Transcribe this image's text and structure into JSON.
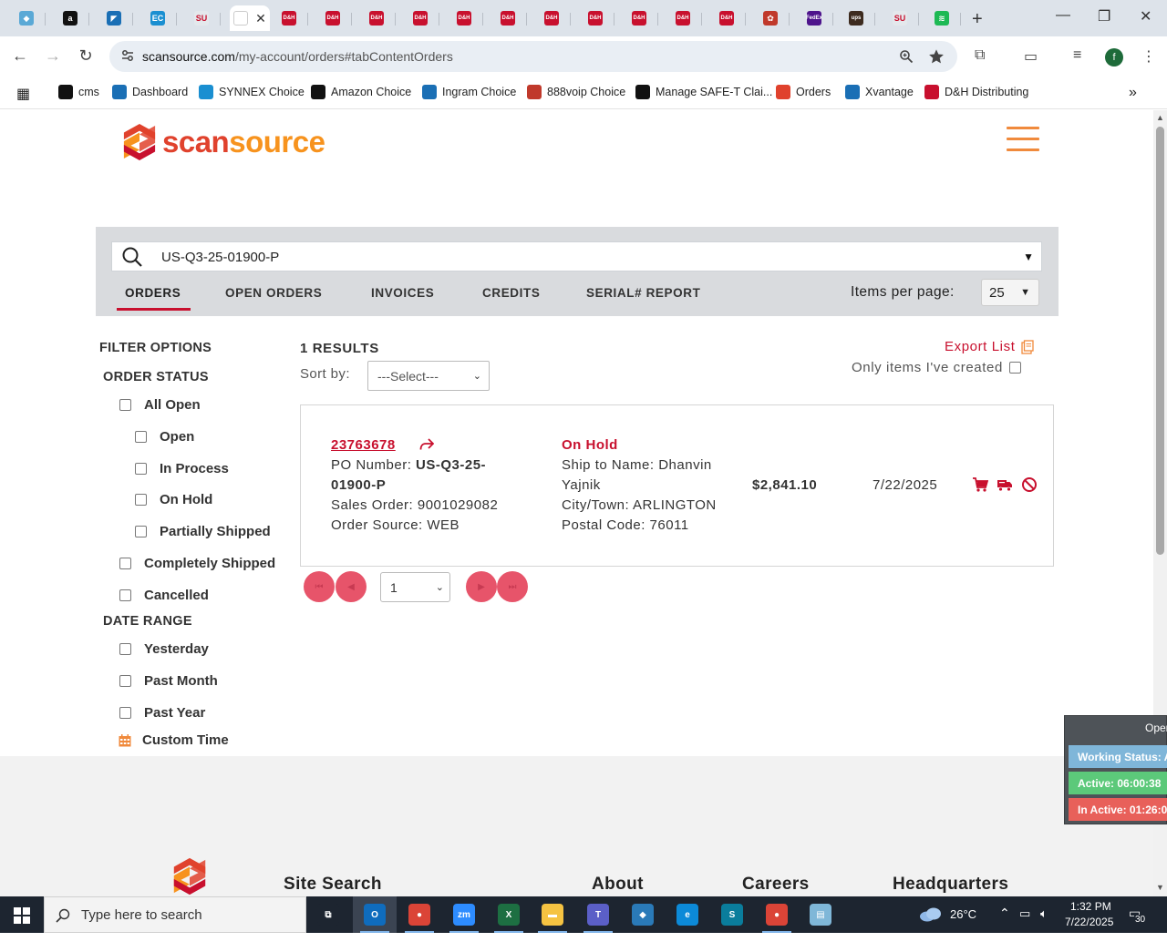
{
  "browser": {
    "active_tab_close": "✕",
    "new_tab": "+",
    "url_host": "scansource.com",
    "url_path": "/my-account/orders#tabContentOrders",
    "window_controls": {
      "minimize": "—",
      "restore": "❐",
      "close": "✕"
    },
    "profile_initial": "f",
    "tabs": [
      {
        "icon": "chrome-icon",
        "color": "#5aa9d6",
        "glyph": "◆"
      },
      {
        "icon": "amazon-icon",
        "color": "#111111",
        "glyph": "a"
      },
      {
        "icon": "ingram-icon",
        "color": "#1a6fb5",
        "glyph": "◤"
      },
      {
        "icon": "ec-icon",
        "color": "#1a8fd1",
        "glyph": "EC"
      },
      {
        "icon": "synnex-icon",
        "color": "#e4e8ec",
        "glyph": "SU"
      },
      {
        "icon": "dh-icon",
        "color": "#c8102e",
        "glyph": "D&H"
      },
      {
        "icon": "dh-icon",
        "color": "#c8102e",
        "glyph": "D&H"
      },
      {
        "icon": "dh-icon",
        "color": "#c8102e",
        "glyph": "D&H"
      },
      {
        "icon": "dh-icon",
        "color": "#c8102e",
        "glyph": "D&H"
      },
      {
        "icon": "dh-icon",
        "color": "#c8102e",
        "glyph": "D&H"
      },
      {
        "icon": "dh-icon",
        "color": "#c8102e",
        "glyph": "D&H"
      },
      {
        "icon": "dh-icon",
        "color": "#c8102e",
        "glyph": "D&H"
      },
      {
        "icon": "dh-icon",
        "color": "#c8102e",
        "glyph": "D&H"
      },
      {
        "icon": "dh-icon",
        "color": "#c8102e",
        "glyph": "D&H"
      },
      {
        "icon": "dh-icon",
        "color": "#c8102e",
        "glyph": "D&H"
      },
      {
        "icon": "dh-icon",
        "color": "#c8102e",
        "glyph": "D&H"
      },
      {
        "icon": "voip-icon",
        "color": "#c0392b",
        "glyph": "✿"
      },
      {
        "icon": "fedex-icon",
        "color": "#4d148c",
        "glyph": "FedEx"
      },
      {
        "icon": "ups-icon",
        "color": "#3d2b1f",
        "glyph": "ups"
      },
      {
        "icon": "synnex-icon",
        "color": "#e4e8ec",
        "glyph": "SU"
      },
      {
        "icon": "spotify-icon",
        "color": "#1db954",
        "glyph": "≋"
      }
    ]
  },
  "bookmarks": [
    {
      "label": "cms",
      "icon": "cms-icon",
      "color": "#111111"
    },
    {
      "label": "Dashboard",
      "icon": "dashboard-icon",
      "color": "#1a6fb5"
    },
    {
      "label": "SYNNEX Choice",
      "icon": "ec-icon",
      "color": "#1a8fd1"
    },
    {
      "label": "Amazon Choice",
      "icon": "amazon-icon",
      "color": "#111111"
    },
    {
      "label": "Ingram Choice",
      "icon": "ingram-icon",
      "color": "#1a6fb5"
    },
    {
      "label": "888voip Choice",
      "icon": "voip-icon",
      "color": "#c0392b"
    },
    {
      "label": "Manage SAFE-T Clai...",
      "icon": "amazon-icon",
      "color": "#111111"
    },
    {
      "label": "Orders",
      "icon": "scansource-icon",
      "color": "#e0422d"
    },
    {
      "label": "Xvantage",
      "icon": "ingram-icon",
      "color": "#1a6fb5"
    },
    {
      "label": "D&H Distributing",
      "icon": "dh-icon",
      "color": "#c8102e"
    }
  ],
  "bookmarks_more": "»",
  "site": {
    "logo_text_a": "scan",
    "logo_text_b": "source",
    "brand_red": "#e0422d",
    "brand_orange": "#f7931e",
    "accent": "#c8102e"
  },
  "search": {
    "query": "US-Q3-25-01900-P",
    "dropdown": "▼"
  },
  "tabs": [
    {
      "label": "ORDERS",
      "active": true
    },
    {
      "label": "OPEN ORDERS"
    },
    {
      "label": "INVOICES"
    },
    {
      "label": "CREDITS"
    },
    {
      "label": "SERIAL# REPORT"
    }
  ],
  "items_per_page": {
    "label": "Items per page:",
    "value": "25",
    "caret": "▼"
  },
  "filters": {
    "title": "FILTER OPTIONS",
    "order_status_title": "ORDER STATUS",
    "order_status": [
      "All Open",
      "Open",
      "In Process",
      "On Hold",
      "Partially Shipped",
      "Completely Shipped",
      "Cancelled"
    ],
    "date_range_title": "DATE RANGE",
    "date_range": [
      "Yesterday",
      "Past Month",
      "Past Year"
    ],
    "custom_time": "Custom Time"
  },
  "results": {
    "count_label": "1 RESULTS",
    "sort_label": "Sort by:",
    "sort_value": "---Select---",
    "export_label": "Export List",
    "only_mine_label": "Only items I've created"
  },
  "order": {
    "number": "23763678",
    "po_label": "PO Number:",
    "po_value_line1": "US-Q3-25-",
    "po_value_line2": "01900-P",
    "sales_order": "Sales Order: 9001029082",
    "order_source": "Order Source: WEB",
    "status": "On Hold",
    "ship_to_line1": "Ship to Name: Dhanvin",
    "ship_to_line2": "Yajnik",
    "city": "City/Town: ARLINGTON",
    "postal": "Postal Code: 76011",
    "amount": "$2,841.10",
    "date": "7/22/2025"
  },
  "pagination": {
    "page": "1",
    "first": "⏮",
    "prev": "◀",
    "next": "▶",
    "last": "⏭"
  },
  "footer": {
    "columns": [
      "Site Search",
      "About",
      "Careers",
      "Headquarters"
    ]
  },
  "widget": {
    "title": "Open",
    "working_status": "Working Status: A",
    "active": "Active: 06:00:38",
    "inactive": "In Active: 01:26:0"
  },
  "taskbar": {
    "search_placeholder": "Type here to search",
    "weather": "26°C",
    "time": "1:32 PM",
    "date": "7/22/2025",
    "notifications": "30",
    "apps": [
      {
        "icon": "task-view-icon",
        "color": "#1d2530",
        "glyph": "⧉"
      },
      {
        "icon": "outlook-icon",
        "color": "#0f6cbd",
        "glyph": "O"
      },
      {
        "icon": "chrome-icon",
        "color": "#db4437",
        "glyph": "●"
      },
      {
        "icon": "zoom-icon",
        "color": "#2d8cff",
        "glyph": "zm"
      },
      {
        "icon": "excel-icon",
        "color": "#1d6f42",
        "glyph": "X"
      },
      {
        "icon": "file-explorer-icon",
        "color": "#f5c342",
        "glyph": "▬"
      },
      {
        "icon": "teams-icon",
        "color": "#5b5fc7",
        "glyph": "T"
      },
      {
        "icon": "app-diamond-icon",
        "color": "#2a7ab8",
        "glyph": "◆"
      },
      {
        "icon": "edge-icon",
        "color": "#0c8ad8",
        "glyph": "e"
      },
      {
        "icon": "sway-icon",
        "color": "#0a7d9c",
        "glyph": "S"
      },
      {
        "icon": "chrome-profile-icon",
        "color": "#db4437",
        "glyph": "●"
      },
      {
        "icon": "notepad-icon",
        "color": "#7fb7d8",
        "glyph": "▤"
      }
    ]
  }
}
